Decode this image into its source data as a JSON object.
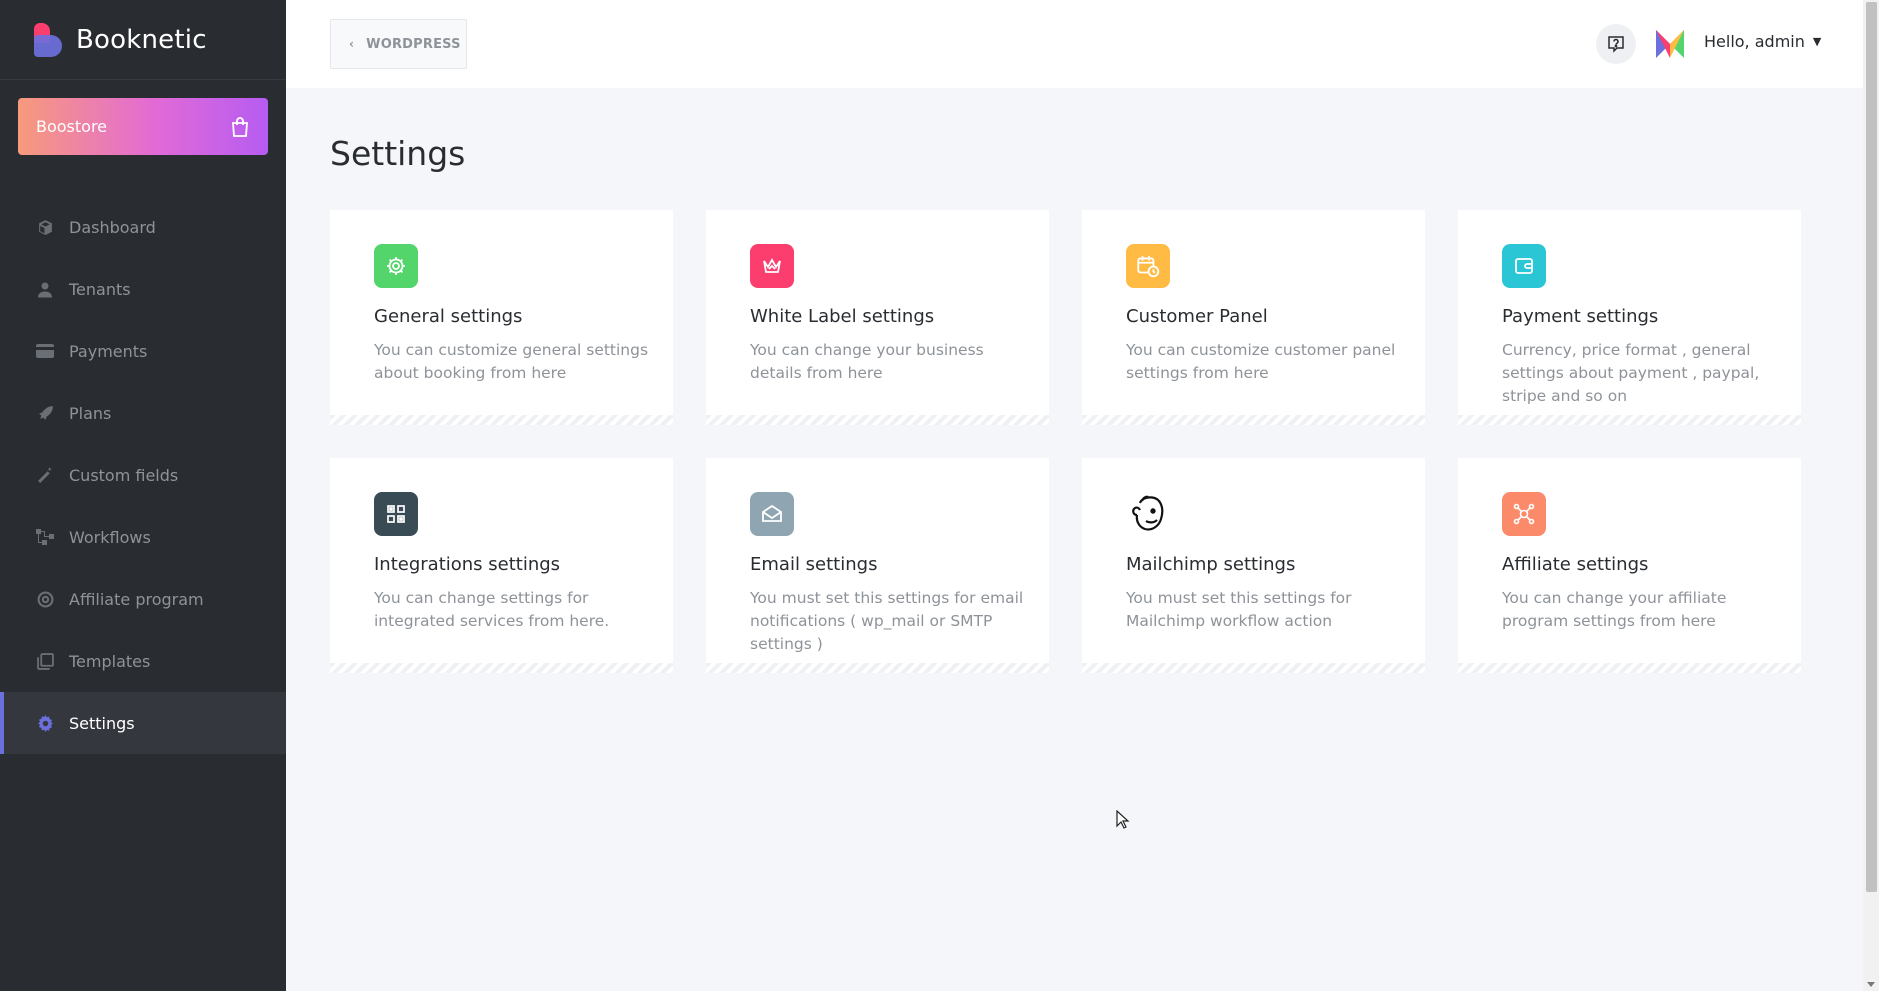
{
  "brand": {
    "name": "Booknetic"
  },
  "boostore": {
    "label": "Boostore"
  },
  "nav": [
    {
      "label": "Dashboard",
      "icon": "cube-icon"
    },
    {
      "label": "Tenants",
      "icon": "user-icon"
    },
    {
      "label": "Payments",
      "icon": "credit-card-icon"
    },
    {
      "label": "Plans",
      "icon": "rocket-icon"
    },
    {
      "label": "Custom fields",
      "icon": "magic-wand-icon"
    },
    {
      "label": "Workflows",
      "icon": "workflow-icon"
    },
    {
      "label": "Affiliate program",
      "icon": "target-icon"
    },
    {
      "label": "Templates",
      "icon": "templates-icon"
    },
    {
      "label": "Settings",
      "icon": "gear-icon",
      "active": true
    }
  ],
  "header": {
    "back_label": "WORDPRESS",
    "greeting": "Hello, admin"
  },
  "page": {
    "title": "Settings"
  },
  "cards": [
    {
      "title": "General settings",
      "desc": "You can customize general settings about booking from here",
      "icon": "gear-icon",
      "color": "#53d56c"
    },
    {
      "title": "White Label settings",
      "desc": "You can change your business details from here",
      "icon": "crown-icon",
      "color": "#fb3e6e"
    },
    {
      "title": "Customer Panel",
      "desc": "You can customize customer panel settings from here",
      "icon": "calendar-clock-icon",
      "color": "#ffbb44"
    },
    {
      "title": "Payment settings",
      "desc": "Currency, price format , general settings about payment , paypal, stripe and so on",
      "icon": "wallet-icon",
      "color": "#2bc6d6"
    },
    {
      "title": "Integrations settings",
      "desc": "You can change settings for integrated services from here.",
      "icon": "integrations-icon",
      "color": "#394b55"
    },
    {
      "title": "Email settings",
      "desc": "You must set this settings for email notifications ( wp_mail or SMTP settings )",
      "icon": "envelope-icon",
      "color": "#8fa6b2"
    },
    {
      "title": "Mailchimp settings",
      "desc": "You must set this settings for Mailchimp workflow action",
      "icon": "mailchimp-icon",
      "color": "#ffffff"
    },
    {
      "title": "Affiliate settings",
      "desc": "You can change your affiliate program settings from here",
      "icon": "affiliate-icon",
      "color": "#fb8a6b"
    }
  ],
  "colors": {
    "sidebar_bg": "#292d32",
    "accent": "#6c70dc",
    "page_bg": "#f5f6f9"
  }
}
